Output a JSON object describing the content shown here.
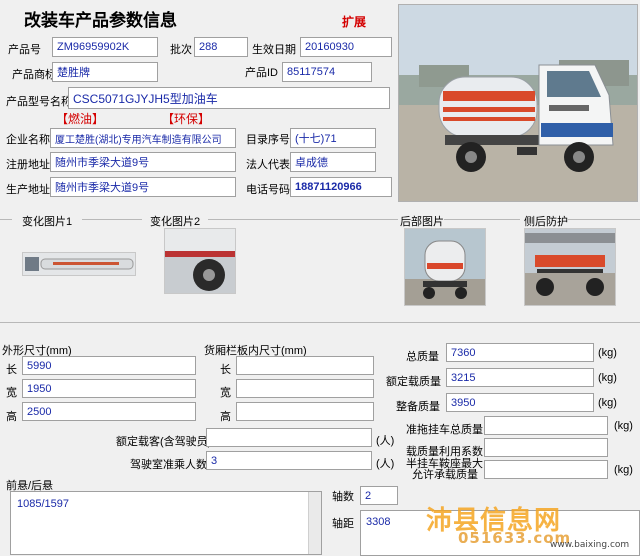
{
  "header": {
    "title": "改装车产品参数信息",
    "expand_link": "扩展"
  },
  "product": {
    "no_label": "产品号",
    "no_value": "ZM96959902K",
    "batch_label": "批次",
    "batch_value": "288",
    "date_label": "生效日期",
    "date_value": "20160930",
    "brand_label": "产品商标",
    "brand_value": "楚胜牌",
    "id_label": "产品ID",
    "id_value": "85117574",
    "model_label": "产品型号名称",
    "model_value": "CSC5071GJYJH5型加油车",
    "tag_fuel": "【燃油】",
    "tag_env": "【环保】"
  },
  "company": {
    "name_label": "企业名称",
    "name_value": "厦工楚胜(湖北)专用汽车制造有限公司",
    "catalog_label": "目录序号",
    "catalog_value": "(十七)71",
    "reg_addr_label": "注册地址",
    "reg_addr_value": "随州市季梁大道9号",
    "legal_label": "法人代表",
    "legal_value": "卓成德",
    "prod_addr_label": "生产地址",
    "prod_addr_value": "随州市季梁大道9号",
    "phone_label": "电话号码",
    "phone_value": "18871120966"
  },
  "images": {
    "change1": "变化图片1",
    "change2": "变化图片2",
    "rear": "后部图片",
    "side_rear": "侧后防护"
  },
  "dims": {
    "outer_label": "外形尺寸(mm)",
    "cargo_label": "货厢栏板内尺寸(mm)",
    "len_label": "长",
    "wid_label": "宽",
    "hei_label": "高",
    "len_value": "5990",
    "wid_value": "1950",
    "hei_value": "2500",
    "cargo_len_value": "",
    "cargo_wid_value": "",
    "cargo_hei_value": ""
  },
  "mass": {
    "total_label": "总质量",
    "total_value": "7360",
    "total_unit": "(kg)",
    "rated_label": "额定载质量",
    "rated_value": "3215",
    "rated_unit": "(kg)",
    "curb_label": "整备质量",
    "curb_value": "3950",
    "curb_unit": "(kg)",
    "trailer_label": "准拖挂车总质量",
    "trailer_value": "",
    "trailer_unit": "(kg)",
    "util_label": "载质量利用系数",
    "util_value": "",
    "saddle_label_1": "半挂车鞍座最大",
    "saddle_label_2": "允许承载质量",
    "saddle_value": "",
    "saddle_unit": "(kg)"
  },
  "passengers": {
    "rated_label": "额定载客(含驾驶员)",
    "rated_value": "",
    "rated_unit": "(人)",
    "cab_label": "驾驶室准乘人数",
    "cab_value": "3",
    "cab_unit": "(人)"
  },
  "axle": {
    "overhang_label": "前悬/后悬",
    "overhang_value": "1085/1597",
    "count_label": "轴数",
    "count_value": "2",
    "base_label": "轴距",
    "base_value": "3308"
  },
  "watermark": {
    "brand": "沛县信息网",
    "sub": "051633.com",
    "url": "www.baixing.com"
  }
}
